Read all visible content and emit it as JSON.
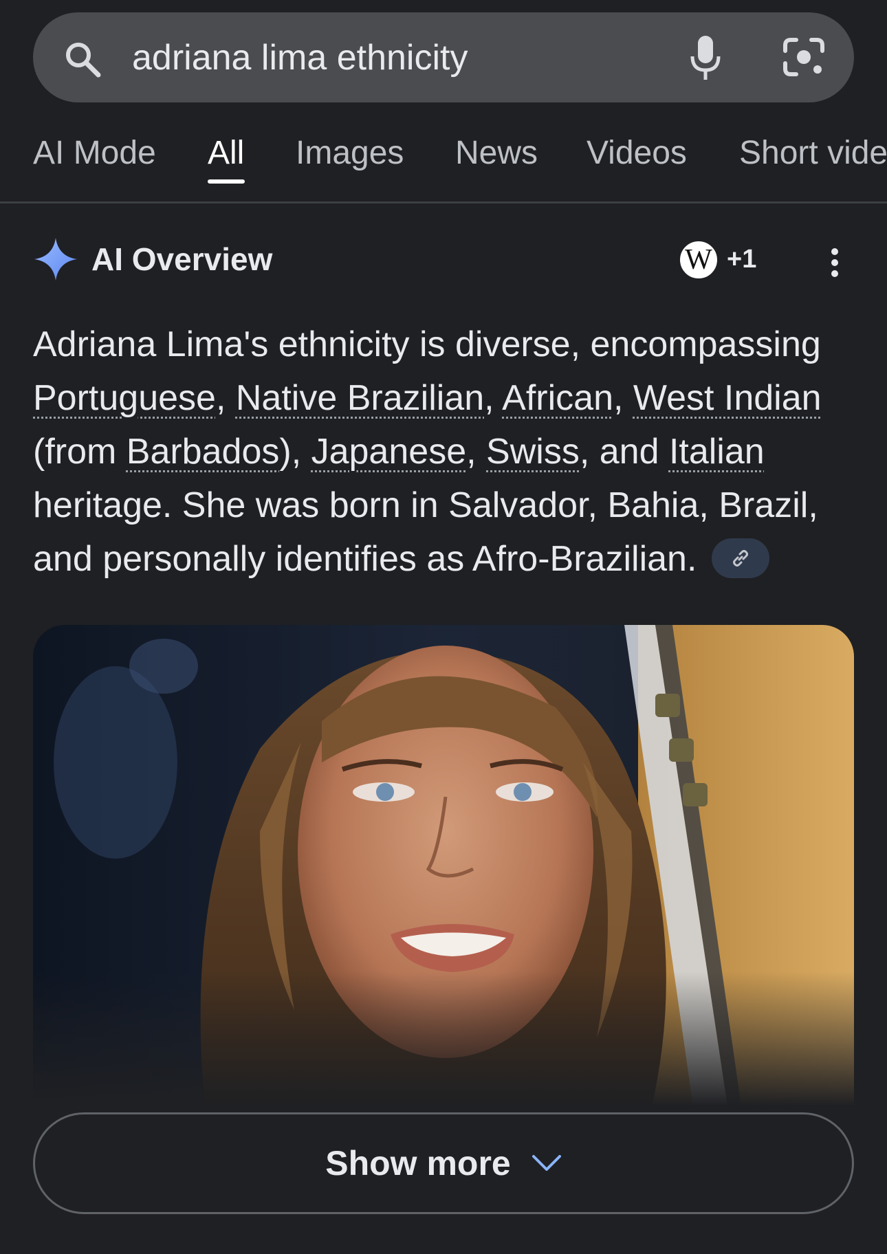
{
  "search": {
    "query": "adriana lima ethnicity",
    "icons": [
      "search-icon",
      "mic-icon",
      "lens-icon"
    ]
  },
  "tabs": [
    {
      "label": "AI Mode",
      "active": false
    },
    {
      "label": "All",
      "active": true
    },
    {
      "label": "Images",
      "active": false
    },
    {
      "label": "News",
      "active": false
    },
    {
      "label": "Videos",
      "active": false
    },
    {
      "label": "Short vide",
      "active": false
    }
  ],
  "ai_overview": {
    "title": "AI Overview",
    "source_icon": "wikipedia-icon",
    "source_logo_letter": "W",
    "source_count": "+1",
    "text": {
      "p1": "Adriana Lima's ethnicity is diverse, encompassing",
      "t_portuguese": "Portuguese",
      "sep1": ", ",
      "t_native": "Native Brazilian",
      "sep2": ", ",
      "t_african": "African",
      "sep3": ", ",
      "t_westindian": "West Indian",
      "p2": "(from ",
      "t_barbados": "Barbados",
      "sep4": "), ",
      "t_japanese": "Japanese",
      "sep5": ", ",
      "t_swiss": "Swiss",
      "sep6": ", and ",
      "t_italian": "Italian",
      "p3": "heritage. She was born in Salvador, Bahia, Brazil,",
      "p4": "and personally identifies as Afro-Brazilian."
    }
  },
  "show_more": {
    "label": "Show more"
  },
  "colors": {
    "background": "#1f2023",
    "search_bar": "#4a4c50",
    "text": "#e8eaed",
    "tab_inactive": "#bdc1c6",
    "spark_blue": "#8ab4f8",
    "chip": "#303a4d"
  }
}
